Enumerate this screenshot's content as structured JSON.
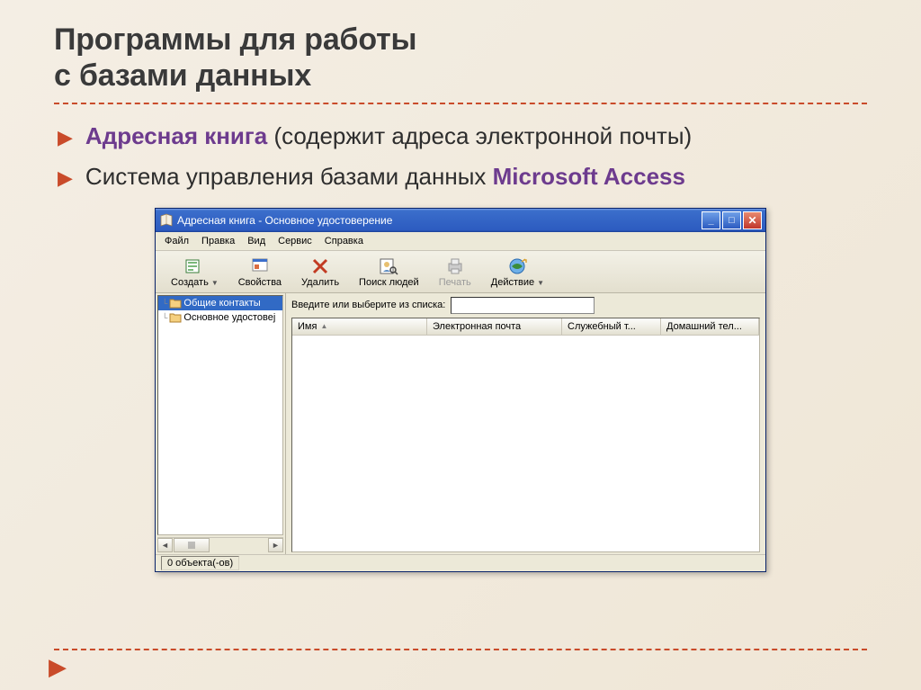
{
  "slide": {
    "title_line1": "Программы для работы",
    "title_line2": "с базами данных"
  },
  "bullets": [
    {
      "emph": "Адресная книга",
      "rest": " (содержит адреса электронной почты)"
    },
    {
      "prefix": "Система управления базами данных ",
      "emph": "Microsoft Access",
      "rest": ""
    }
  ],
  "window": {
    "title": "Адресная книга - Основное удостоверение",
    "menu": [
      "Файл",
      "Правка",
      "Вид",
      "Сервис",
      "Справка"
    ],
    "toolbar": {
      "create": "Создать",
      "props": "Свойства",
      "delete": "Удалить",
      "find": "Поиск людей",
      "print": "Печать",
      "action": "Действие"
    },
    "tree": {
      "shared": "Общие контакты",
      "main": "Основное удостовеј"
    },
    "search_label": "Введите или выберите из списка:",
    "columns": {
      "name": "Имя",
      "email": "Электронная почта",
      "work": "Служебный т...",
      "home": "Домашний тел..."
    },
    "status": "0 объекта(-ов)"
  }
}
